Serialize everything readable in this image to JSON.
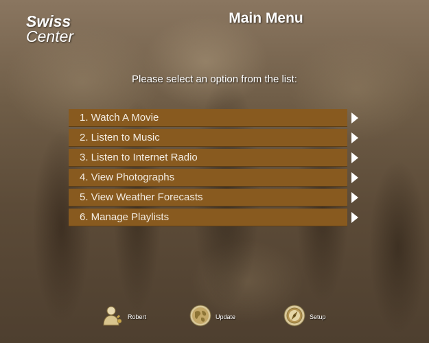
{
  "logo": {
    "line1": "Swiss",
    "line2": "Center"
  },
  "header": {
    "title": "Main Menu"
  },
  "prompt": "Please select an option from the list:",
  "menu": {
    "items": [
      {
        "label": "1. Watch A Movie"
      },
      {
        "label": "2. Listen to Music"
      },
      {
        "label": "3. Listen to Internet Radio"
      },
      {
        "label": "4. View Photographs"
      },
      {
        "label": "5. View Weather Forecasts"
      },
      {
        "label": "6. Manage Playlists"
      }
    ]
  },
  "footer": {
    "user": {
      "label": "Robert",
      "icon": "user-icon"
    },
    "update": {
      "label": "Update",
      "icon": "globe-icon"
    },
    "setup": {
      "label": "Setup",
      "icon": "compass-icon"
    }
  },
  "colors": {
    "menu_bar": "#885a1f",
    "text": "#ffffff",
    "arrow": "#ffffff"
  }
}
